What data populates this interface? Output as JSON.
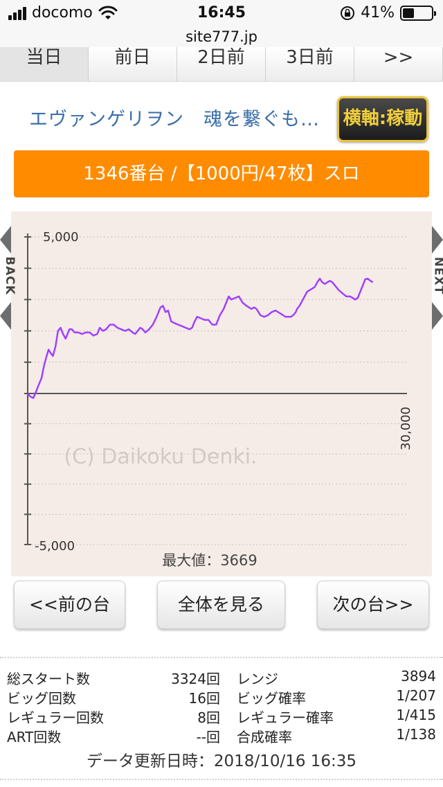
{
  "status_bar": {
    "carrier": "docomo",
    "time": "16:45",
    "battery_percent": "41%",
    "battery_level": 0.41
  },
  "browser": {
    "url": "site777.jp"
  },
  "day_tabs": [
    "当日",
    "前日",
    "2日前",
    "3日前",
    ">>"
  ],
  "machine_name": "エヴァンゲリヲン　魂を繋ぐも…",
  "axis_button_label": "横軸:稼動",
  "banner_text": "1346番台 /【1000円/47枚】スロ",
  "chart_data": {
    "type": "line",
    "x_max_label": "30,000",
    "xlim": [
      0,
      30000
    ],
    "ylim": [
      -5000,
      5000
    ],
    "y_ticks": [
      5000,
      4000,
      3000,
      2000,
      1000,
      0,
      -1000,
      -2000,
      -3000,
      -4000,
      -5000
    ],
    "y_tick_labels": {
      "top": "5,000",
      "bottom": "-5,000"
    },
    "watermark": "(C) Daikoku Denki.",
    "max_label": "最大値：3669",
    "line_color": "#a040ff",
    "series": [
      {
        "x": [
          0,
          200,
          450,
          700,
          900,
          1100,
          1300,
          1500,
          1650,
          1800,
          2000,
          2200,
          2400,
          2600,
          2800,
          3000,
          3300,
          3500,
          3700,
          4000,
          4300,
          4600,
          4900,
          5200,
          5500,
          5700,
          5950,
          6200,
          6500,
          6800,
          7100,
          7400,
          7700,
          8000,
          8300,
          8500,
          8700,
          8900,
          9100,
          9300,
          9600,
          9900,
          10200,
          10500,
          10700,
          10900,
          11100,
          11350,
          11600,
          11900,
          12200,
          12500,
          12800,
          13000,
          13200,
          13400,
          13700,
          14000,
          14300,
          14600,
          14900,
          15200,
          15500,
          15700,
          15900,
          16100,
          16400,
          16700,
          17000,
          17300,
          17500,
          17700,
          17900,
          18100,
          18400,
          18700,
          19000,
          19300,
          19600,
          19800,
          20000,
          20200,
          20400,
          20600,
          20800,
          21000,
          21200,
          21300,
          21500,
          21700,
          21900,
          22100,
          22300,
          22500,
          22700,
          22900,
          23100,
          23300,
          23500,
          23700,
          23900,
          24100,
          24300,
          24600,
          24900,
          25200,
          25500,
          25700,
          25900,
          26100,
          26300,
          26500,
          26700,
          26900,
          27100,
          27300
        ],
        "y": [
          0,
          -100,
          -150,
          100,
          300,
          500,
          900,
          1200,
          1400,
          1300,
          1200,
          1500,
          2000,
          2100,
          1900,
          1750,
          2050,
          2050,
          1950,
          1950,
          1900,
          1950,
          1950,
          1850,
          1900,
          2100,
          2000,
          2050,
          2200,
          2200,
          2100,
          2050,
          2000,
          2050,
          1950,
          1900,
          2000,
          2100,
          2050,
          1950,
          2050,
          2200,
          2450,
          2750,
          2800,
          2600,
          2650,
          2300,
          2250,
          2200,
          2150,
          2100,
          2050,
          2100,
          2300,
          2450,
          2400,
          2350,
          2350,
          2200,
          2200,
          2500,
          2700,
          2900,
          3100,
          3000,
          3050,
          3100,
          2900,
          2800,
          2750,
          2700,
          2750,
          2700,
          2500,
          2450,
          2500,
          2600,
          2650,
          2600,
          2550,
          2500,
          2450,
          2450,
          2450,
          2500,
          2600,
          2700,
          2800,
          2950,
          3100,
          3250,
          3300,
          3350,
          3400,
          3550,
          3669,
          3550,
          3500,
          3550,
          3600,
          3550,
          3450,
          3300,
          3200,
          3100,
          3100,
          3050,
          3000,
          3050,
          3250,
          3450,
          3650,
          3669,
          3600,
          3550
        ]
      }
    ]
  },
  "nav_buttons": {
    "prev": "<<前の台",
    "all": "全体を見る",
    "next": "次の台>>"
  },
  "side_labels": {
    "back": "BACK",
    "next": "NEXT"
  },
  "stats": [
    {
      "k1": "総スタート数",
      "v1": "3324回",
      "k2": "レンジ",
      "v2": "3894"
    },
    {
      "k1": "ビッグ回数",
      "v1": "16回",
      "k2": "ビッグ確率",
      "v2": "1/207"
    },
    {
      "k1": "レギュラー回数",
      "v1": "8回",
      "k2": "レギュラー確率",
      "v2": "1/415"
    },
    {
      "k1": "ART回数",
      "v1": "--回",
      "k2": "合成確率",
      "v2": "1/138"
    }
  ],
  "updated": "データ更新日時：2018/10/16 16:35"
}
